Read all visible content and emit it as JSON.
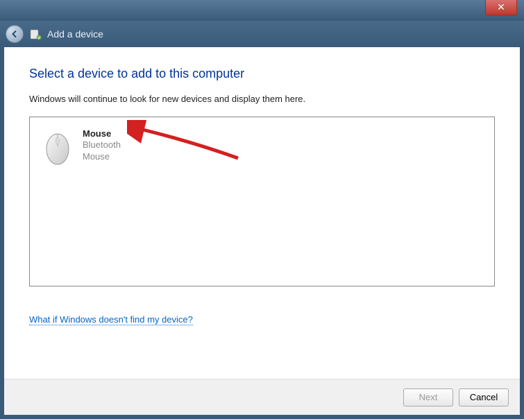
{
  "window": {
    "title": "Add a device"
  },
  "main": {
    "heading": "Select a device to add to this computer",
    "subtext": "Windows will continue to look for new devices and display them here.",
    "help_link": "What if Windows doesn't find my device?"
  },
  "devices": [
    {
      "name": "Mouse",
      "type": "Bluetooth",
      "sub": "Mouse"
    }
  ],
  "footer": {
    "next_label": "Next",
    "cancel_label": "Cancel"
  }
}
